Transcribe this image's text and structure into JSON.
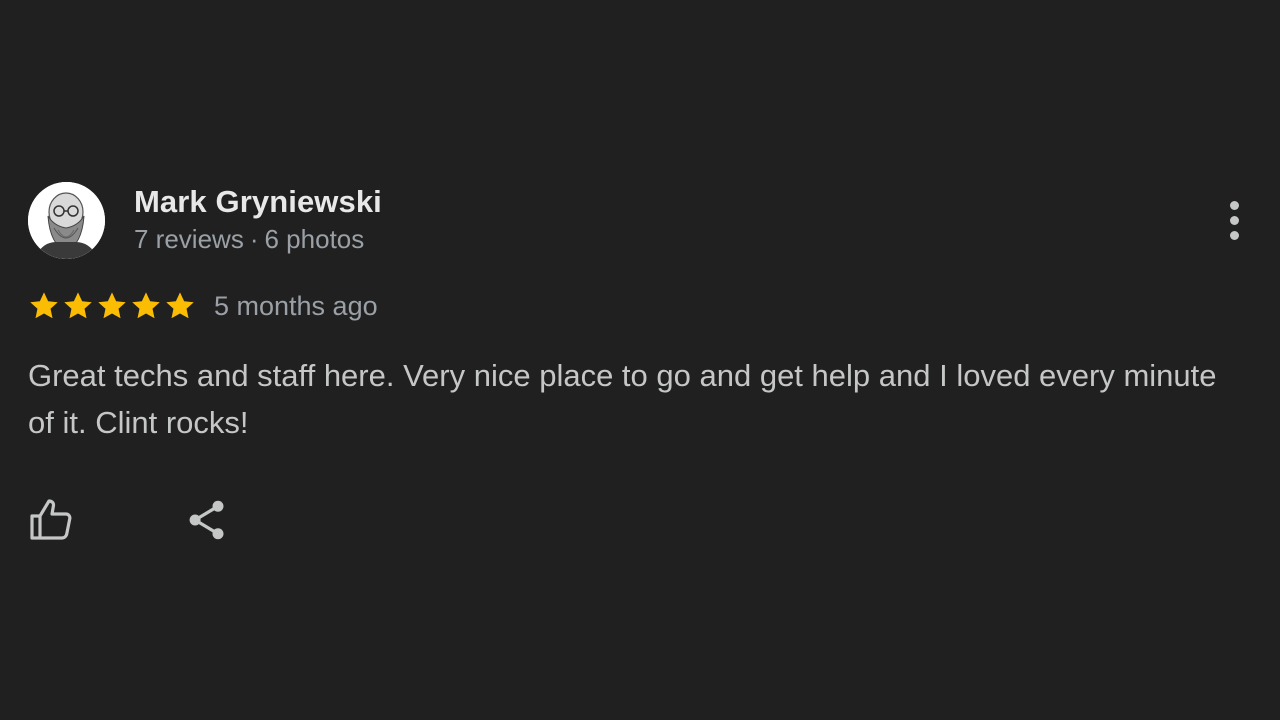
{
  "review": {
    "author": {
      "name": "Mark Gryniewski",
      "reviews": "7 reviews",
      "separator": "·",
      "photos": "6 photos"
    },
    "rating": 5,
    "rating_max": 5,
    "time_ago": "5 months ago",
    "text": "Great techs and staff here. Very nice place to go and get help and I loved every minute of it. Clint rocks!",
    "icons": {
      "avatar": "avatar-photo",
      "star": "star-icon",
      "more": "more-vert-icon",
      "like": "thumb-up-icon",
      "share": "share-icon"
    }
  },
  "colors": {
    "background": "#202020",
    "star": "#fbbc04",
    "name": "#e8e8e8",
    "meta": "#9aa0a6",
    "text": "#c4c7c5"
  }
}
